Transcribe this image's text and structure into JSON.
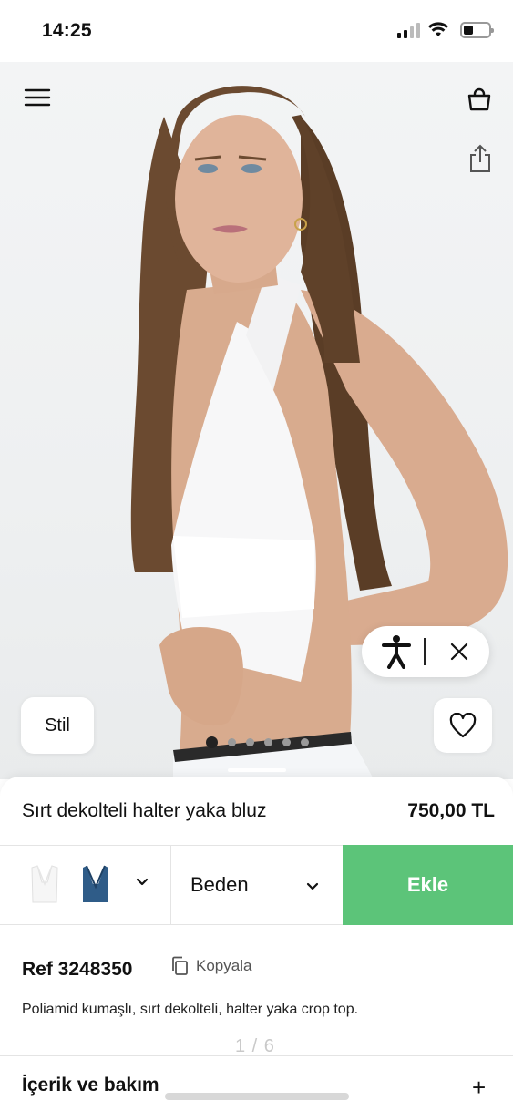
{
  "status_bar": {
    "time": "14:25"
  },
  "header": {
    "menu_icon": "menu-icon",
    "bag_icon": "shopping-bag-icon",
    "share_icon": "share-icon"
  },
  "accessibility_widget": {
    "icon": "accessibility-person-icon",
    "close_icon": "close-icon"
  },
  "gallery": {
    "stil_label": "Stil",
    "favorite_icon": "heart-icon",
    "image_count": 6,
    "active_index": 1,
    "pager_text": "1 / 6"
  },
  "product": {
    "title": "Sırt dekolteli halter yaka bluz",
    "price": "750,00 TL",
    "colors": [
      {
        "name": "white",
        "hex": "#f4f4f4"
      },
      {
        "name": "blue",
        "hex": "#2f5c88"
      }
    ],
    "size_label": "Beden",
    "add_label": "Ekle",
    "add_color": "#5cc479",
    "reference": "Ref 3248350",
    "copy_label": "Kopyala",
    "description": "Poliamid kumaşlı, sırt dekolteli, halter yaka crop top.",
    "care_label": "İçerik ve bakım",
    "care_toggle": "+"
  }
}
